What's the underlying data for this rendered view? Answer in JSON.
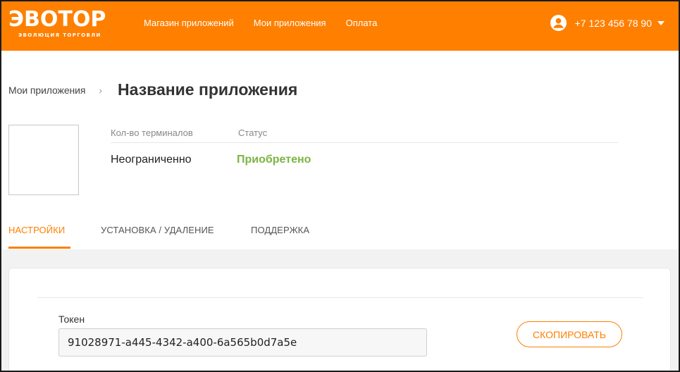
{
  "header": {
    "logo_main": "ЭВОТОР",
    "logo_sub": "ЭВОЛЮЦИЯ ТОРГОВЛИ",
    "nav": [
      {
        "label": "Магазин приложений"
      },
      {
        "label": "Мои приложения"
      },
      {
        "label": "Оплата"
      }
    ],
    "phone": "+7 123 456 78 90",
    "user_icon": "user-circle-icon",
    "caret_icon": "caret-down-icon"
  },
  "breadcrumb": {
    "parent": "Мои приложения",
    "separator": "›",
    "title": "Название приложения"
  },
  "app_info": {
    "terminals_label": "Кол-во терминалов",
    "status_label": "Статус",
    "terminals_value": "Неограниченно",
    "status_value": "Приобретено",
    "status_color": "#7cb442"
  },
  "tabs": [
    {
      "label": "Настройки",
      "active": true
    },
    {
      "label": "Установка / удаление",
      "active": false
    },
    {
      "label": "Поддержка",
      "active": false
    }
  ],
  "settings": {
    "token_label": "Токен",
    "token_value": "91028971-a445-4342-a400-6a565b0d7a5e",
    "copy_label": "Скопировать"
  },
  "colors": {
    "brand": "#ff7f00",
    "success": "#7cb442",
    "panel_bg": "#f2f2f2"
  }
}
